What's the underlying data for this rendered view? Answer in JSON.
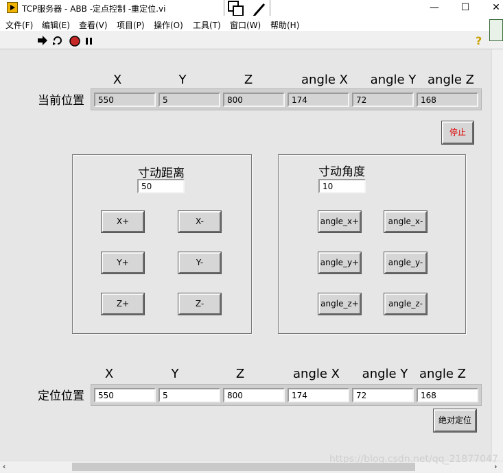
{
  "window": {
    "title": "TCP服务器 - ABB -定点控制 -重定位.vi",
    "minimize": "—",
    "maximize": "☐",
    "close": "✕"
  },
  "menu": [
    "文件(F)",
    "编辑(E)",
    "查看(V)",
    "项目(P)",
    "操作(O)",
    "工具(T)",
    "窗口(W)",
    "帮助(H)"
  ],
  "toolbar": {
    "run_icon": "run-arrow-icon",
    "run_continuous_icon": "run-continuously-icon",
    "abort_icon": "abort-icon",
    "pause_icon": "pause-icon",
    "help_icon": "help-icon",
    "help": "?"
  },
  "current": {
    "label": "当前位置",
    "headers": [
      "X",
      "Y",
      "Z",
      "angle X",
      "angle Y",
      "angle Z"
    ],
    "values": [
      "550",
      "5",
      "800",
      "174",
      "72",
      "168"
    ]
  },
  "stop_label": "停止",
  "jog_distance": {
    "title": "寸动距离",
    "value": "50",
    "buttons": [
      "X+",
      "X-",
      "Y+",
      "Y-",
      "Z+",
      "Z-"
    ]
  },
  "jog_angle": {
    "title": "寸动角度",
    "value": "10",
    "buttons": [
      "angle_x+",
      "angle_x-",
      "angle_y+",
      "angle_y-",
      "angle_z+",
      "angle_z-"
    ]
  },
  "target": {
    "label": "定位位置",
    "headers": [
      "X",
      "Y",
      "Z",
      "angle X",
      "angle Y",
      "angle Z"
    ],
    "values": [
      "550",
      "5",
      "800",
      "174",
      "72",
      "168"
    ]
  },
  "absolute_label": "绝对定位",
  "watermark": "https://blog.csdn.net/qq_21877047"
}
